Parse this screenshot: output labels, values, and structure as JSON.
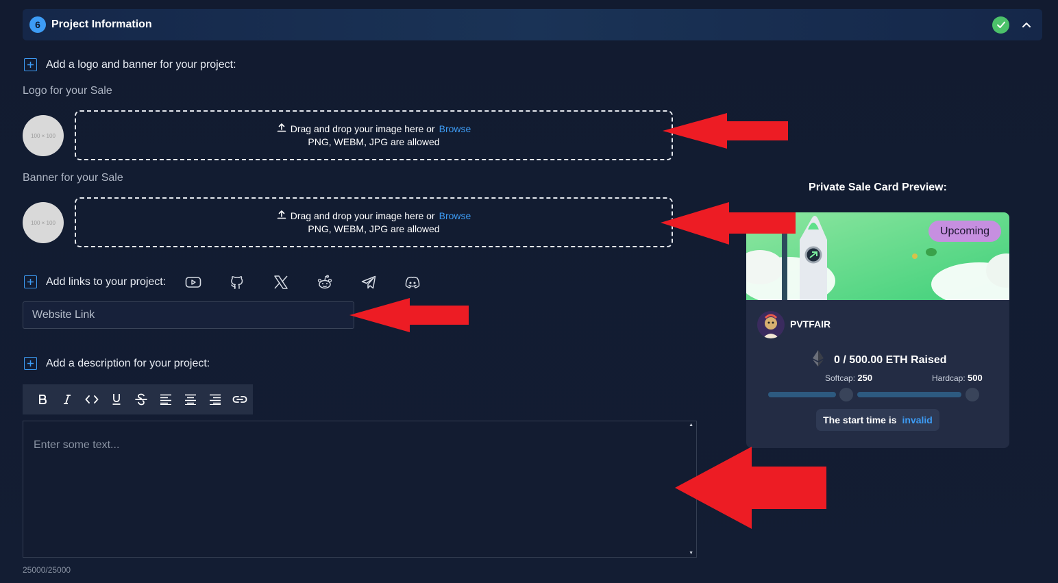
{
  "section": {
    "step": "6",
    "title": "Project Information"
  },
  "logo_banner": {
    "heading": "Add a logo and banner for your project:",
    "logo_label": "Logo for your Sale",
    "banner_label": "Banner for your Sale",
    "placeholder_text": "100 × 100",
    "dropzone": {
      "text": "Drag and drop your image here or",
      "browse": "Browse",
      "allowed": "PNG, WEBM, JPG are allowed"
    }
  },
  "links": {
    "heading": "Add links to your project:",
    "icons": [
      "youtube-icon",
      "github-icon",
      "x-twitter-icon",
      "reddit-icon",
      "telegram-icon",
      "discord-icon"
    ],
    "website_placeholder": "Website Link"
  },
  "description": {
    "heading": "Add a description for your project:",
    "toolbar": [
      "bold",
      "italic",
      "code",
      "underline",
      "strikethrough",
      "align-left",
      "align-center",
      "align-right",
      "link"
    ],
    "placeholder": "Enter some text...",
    "char_count": "25000/25000"
  },
  "preview": {
    "title": "Private Sale Card Preview:",
    "status": "Upcoming",
    "token_name": "PVTFAIR",
    "raised": "0 / 500.00 ETH Raised",
    "softcap_label": "Softcap:",
    "softcap_value": "250",
    "hardcap_label": "Hardcap:",
    "hardcap_value": "500",
    "start_text": "The start time is",
    "start_status": "invalid"
  },
  "colors": {
    "accent": "#3d9cf5",
    "success": "#4cc16a",
    "badge": "#c68fe0",
    "annotation_arrow": "#ed1c24"
  }
}
